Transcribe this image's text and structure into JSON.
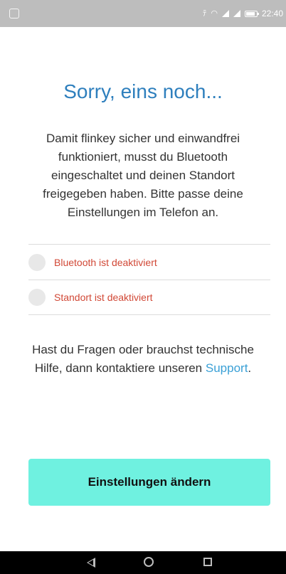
{
  "status_bar": {
    "time": "22:40",
    "icons": [
      "app-notification-icon",
      "vibrate-icon",
      "wifi-icon",
      "signal-icon",
      "signal-icon",
      "battery-icon"
    ]
  },
  "main": {
    "title": "Sorry, eins noch...",
    "description": "Damit flinkey sicher und einwandfrei funktioniert, musst du Bluetooth eingeschaltet und deinen Standort freigegeben haben. Bitte passe deine Einstellungen im Telefon an.",
    "status_items": [
      {
        "label": "Bluetooth ist deaktiviert"
      },
      {
        "label": "Standort ist deaktiviert"
      }
    ],
    "help_text": "Hast du Fragen oder brauchst technische Hilfe, dann kontaktiere unseren",
    "support_link": "Support",
    "help_suffix": ".",
    "cta_label": "Einstellungen ändern"
  },
  "colors": {
    "title": "#2e7fbd",
    "warning": "#d14836",
    "link": "#3aa0d6",
    "cta_bg": "#6ff1e0",
    "status_bar_bg": "#bdbdbd",
    "nav_bar_bg": "#000000"
  },
  "nav_bar": {
    "icons": [
      "back-icon",
      "home-icon",
      "recents-icon"
    ]
  }
}
